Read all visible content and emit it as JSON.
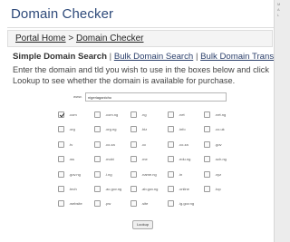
{
  "page": {
    "title": "Domain Checker"
  },
  "breadcrumb": {
    "home": "Portal Home",
    "separator": ">",
    "current": "Domain Checker"
  },
  "tabs": {
    "current": "Simple Domain Search",
    "bulk_search": "Bulk Domain Search",
    "bulk_transfer": "Bulk Domain Transfer",
    "separator": "|"
  },
  "intro": "Enter the domain and tld you wish to use in the boxes below and click Lookup to see whether the domain is available for purchase.",
  "domain_field": {
    "label": "www.",
    "value": "nigeriaganicho"
  },
  "tlds": [
    {
      "label": ".com",
      "checked": true
    },
    {
      "label": ".com.ng",
      "checked": false
    },
    {
      "label": ".ng",
      "checked": false
    },
    {
      "label": ".net",
      "checked": false
    },
    {
      "label": ".net.ng",
      "checked": false
    },
    {
      "label": ".org",
      "checked": false
    },
    {
      "label": ".org.ng",
      "checked": false
    },
    {
      "label": ".biz",
      "checked": false
    },
    {
      "label": ".info",
      "checked": false
    },
    {
      "label": ".co.uk",
      "checked": false
    },
    {
      "label": ".tv",
      "checked": false
    },
    {
      "label": ".co.za",
      "checked": false
    },
    {
      "label": ".cc",
      "checked": false
    },
    {
      "label": ".co.za",
      "checked": false
    },
    {
      "label": ".gov",
      "checked": false
    },
    {
      "label": ".ws",
      "checked": false
    },
    {
      "label": ".mobi",
      "checked": false
    },
    {
      "label": ".me",
      "checked": false
    },
    {
      "label": ".edu.ng",
      "checked": false
    },
    {
      "label": ".sch.ng",
      "checked": false
    },
    {
      "label": ".gov.ng",
      "checked": false
    },
    {
      "label": ".i.ng",
      "checked": false
    },
    {
      "label": ".name.ng",
      "checked": false
    },
    {
      "label": ".in",
      "checked": false
    },
    {
      "label": ".xyz",
      "checked": false
    },
    {
      "label": ".tech",
      "checked": false
    },
    {
      "label": ".ac.gov.ng",
      "checked": false
    },
    {
      "label": ".ab.gov.ng",
      "checked": false
    },
    {
      "label": ".online",
      "checked": false
    },
    {
      "label": ".top",
      "checked": false
    },
    {
      "label": ".website",
      "checked": false
    },
    {
      "label": ".pw",
      "checked": false
    },
    {
      "label": ".site",
      "checked": false
    },
    {
      "label": ".ig.gov.ng",
      "checked": false
    }
  ],
  "lookup_button": "Lookup",
  "right_strip": [
    "M",
    "A",
    "L"
  ]
}
